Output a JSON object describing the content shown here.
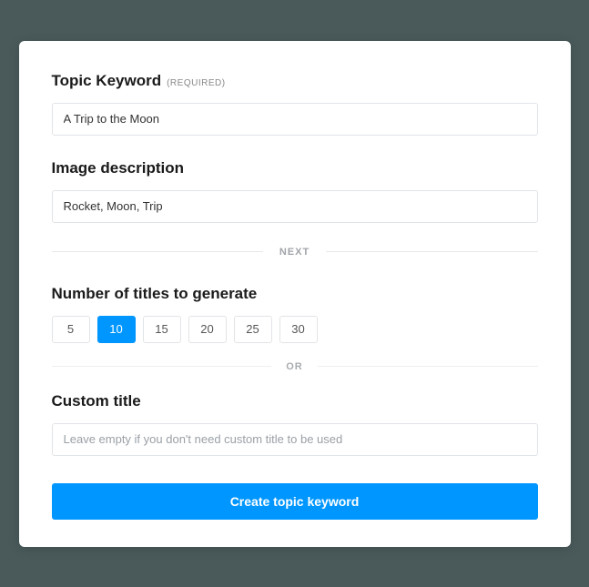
{
  "topic": {
    "label": "Topic Keyword",
    "required_tag": "(REQUIRED)",
    "value": "A Trip to the Moon"
  },
  "image_desc": {
    "label": "Image description",
    "value": "Rocket, Moon, Trip"
  },
  "divider_next": "NEXT",
  "titles_count": {
    "label": "Number of titles to generate",
    "options": [
      "5",
      "10",
      "15",
      "20",
      "25",
      "30"
    ],
    "selected": "10"
  },
  "divider_or": "OR",
  "custom_title": {
    "label": "Custom title",
    "placeholder": "Leave empty if you don't need custom title to be used",
    "value": ""
  },
  "submit_label": "Create topic keyword"
}
